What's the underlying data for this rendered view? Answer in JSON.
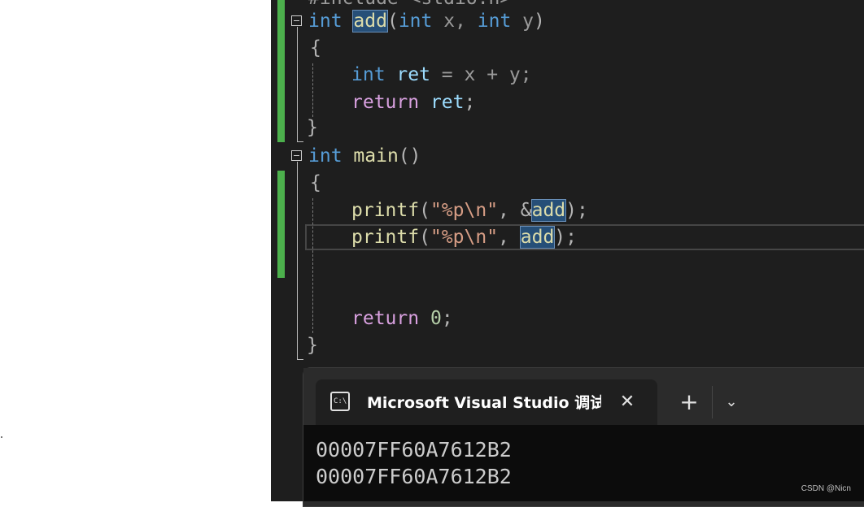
{
  "editor": {
    "top_line_partial": "#include <stdio.h>",
    "lines": [
      {
        "t1": "int",
        "fn": "add",
        "p1": "(",
        "kw2": "int",
        "a": " x, ",
        "kw3": "int",
        "b": " y",
        "p2": ")"
      },
      {
        "text": "{"
      },
      {
        "kw": "int",
        "var": "ret",
        "rest": " = x + y;"
      },
      {
        "kw": "return",
        "var": "ret",
        "rest": ";"
      },
      {
        "text": "}"
      },
      {
        "kw": "int",
        "fn": "main",
        "rest": "()"
      },
      {
        "text": "{"
      },
      {
        "fn": "printf",
        "p1": "(",
        "str": "\"%p\\n\"",
        "mid": ", &",
        "hl": "add",
        "end": ");"
      },
      {
        "fn": "printf",
        "p1": "(",
        "str": "\"%p\\n\"",
        "mid": ", ",
        "hl": "add",
        "end": ");"
      },
      {
        "kw": "return",
        "num": "0",
        "rest": ";"
      },
      {
        "text": "}"
      }
    ]
  },
  "console": {
    "tab_icon_text": "C:\\",
    "tab_title": "Microsoft Visual Studio 调试控制台",
    "close_glyph": "✕",
    "add_glyph": "+",
    "dropdown_glyph": "⌄",
    "output": [
      "00007FF60A7612B2",
      "00007FF60A7612B2"
    ]
  },
  "watermark": "CSDN @Nicn",
  "colors": {
    "editor_bg": "#1e1e1e",
    "keyword": "#569cd6",
    "control_keyword": "#d8a0df",
    "function": "#dcdcaa",
    "variable": "#9cdcfe",
    "string": "#d69d85",
    "change_bar": "#4cb04c",
    "selection": "#264f78"
  }
}
